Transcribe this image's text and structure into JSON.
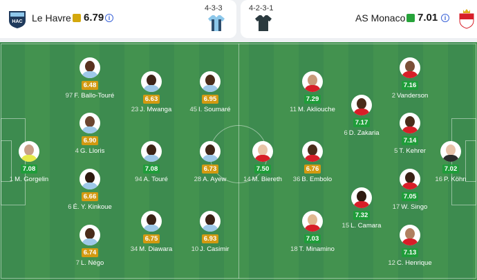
{
  "home": {
    "name": "Le Havre",
    "rating": "6.79",
    "rating_color": "#d4a80d",
    "formation": "4-3-3",
    "crest_text": "HAC",
    "shirt_colors": [
      "#2d4d6d",
      "#8cc7ea"
    ]
  },
  "away": {
    "name": "AS Monaco",
    "rating": "7.01",
    "rating_color": "#27a33a",
    "formation": "4-2-3-1",
    "shirt_color": "#2b3a3f",
    "crest_colors": [
      "#d71e28",
      "#ffffff"
    ]
  },
  "info_icon": "i",
  "players": [
    {
      "num": "97",
      "name": "F. Ballo-Touré",
      "rating": "6.48",
      "grade": "orange",
      "skin": "#5a3320",
      "kit": "#9ec8e8"
    },
    {
      "num": "23",
      "name": "J. Mwanga",
      "rating": "6.63",
      "grade": "orange",
      "skin": "#3e2418",
      "kit": "#9ec8e8"
    },
    {
      "num": "45",
      "name": "I. Soumaré",
      "rating": "6.95",
      "grade": "orange",
      "skin": "#4a2c1a",
      "kit": "#9ec8e8"
    },
    {
      "num": "4",
      "name": "G. Lloris",
      "rating": "6.90",
      "grade": "orange",
      "skin": "#6b4530",
      "kit": "#9ec8e8"
    },
    {
      "num": "1",
      "name": "M. Gorgelin",
      "rating": "7.08",
      "grade": "green",
      "skin": "#c9a088",
      "kit": "#e6e94a"
    },
    {
      "num": "94",
      "name": "A. Touré",
      "rating": "7.08",
      "grade": "green",
      "skin": "#3d2416",
      "kit": "#9ec8e8"
    },
    {
      "num": "28",
      "name": "A. Ayew",
      "rating": "6.73",
      "grade": "orange",
      "skin": "#3f2618",
      "kit": "#9ec8e8"
    },
    {
      "num": "6",
      "name": "É. Y. Kinkoue",
      "rating": "6.66",
      "grade": "orange",
      "skin": "#2e1a10",
      "kit": "#9ec8e8"
    },
    {
      "num": "34",
      "name": "M. Diawara",
      "rating": "6.75",
      "grade": "orange",
      "skin": "#3a2216",
      "kit": "#9ec8e8"
    },
    {
      "num": "10",
      "name": "J. Casimir",
      "rating": "6.93",
      "grade": "orange",
      "skin": "#3a2216",
      "kit": "#9ec8e8"
    },
    {
      "num": "7",
      "name": "L. Négo",
      "rating": "6.74",
      "grade": "orange",
      "skin": "#4a2c1a",
      "kit": "#9ec8e8"
    },
    {
      "num": "11",
      "name": "M. Akliouche",
      "rating": "7.29",
      "grade": "green",
      "skin": "#c89a7a",
      "kit": "#d71e28"
    },
    {
      "num": "6",
      "name": "D. Zakaria",
      "rating": "7.17",
      "grade": "green",
      "skin": "#4a2c1a",
      "kit": "#d71e28"
    },
    {
      "num": "2",
      "name": "Vanderson",
      "rating": "7.16",
      "grade": "green",
      "skin": "#7a5038",
      "kit": "#d71e28"
    },
    {
      "num": "5",
      "name": "T. Kehrer",
      "rating": "7.14",
      "grade": "green",
      "skin": "#4a2c1a",
      "kit": "#d71e28"
    },
    {
      "num": "14",
      "name": "M. Biereth",
      "rating": "7.50",
      "grade": "green",
      "skin": "#e8c4a8",
      "kit": "#d71e28"
    },
    {
      "num": "36",
      "name": "B. Embolo",
      "rating": "6.76",
      "grade": "orange",
      "skin": "#4a2c1a",
      "kit": "#d71e28"
    },
    {
      "num": "16",
      "name": "P. Köhn",
      "rating": "7.02",
      "grade": "green",
      "skin": "#e6c2a8",
      "kit": "#2b2b2b"
    },
    {
      "num": "17",
      "name": "W. Singo",
      "rating": "7.05",
      "grade": "green",
      "skin": "#3a2216",
      "kit": "#d71e28"
    },
    {
      "num": "15",
      "name": "L. Camara",
      "rating": "7.32",
      "grade": "green",
      "skin": "#2e1a10",
      "kit": "#d71e28"
    },
    {
      "num": "18",
      "name": "T. Minamino",
      "rating": "7.03",
      "grade": "green",
      "skin": "#e0b890",
      "kit": "#d71e28"
    },
    {
      "num": "12",
      "name": "C. Henrique",
      "rating": "7.13",
      "grade": "green",
      "skin": "#b08060",
      "kit": "#d71e28"
    }
  ]
}
